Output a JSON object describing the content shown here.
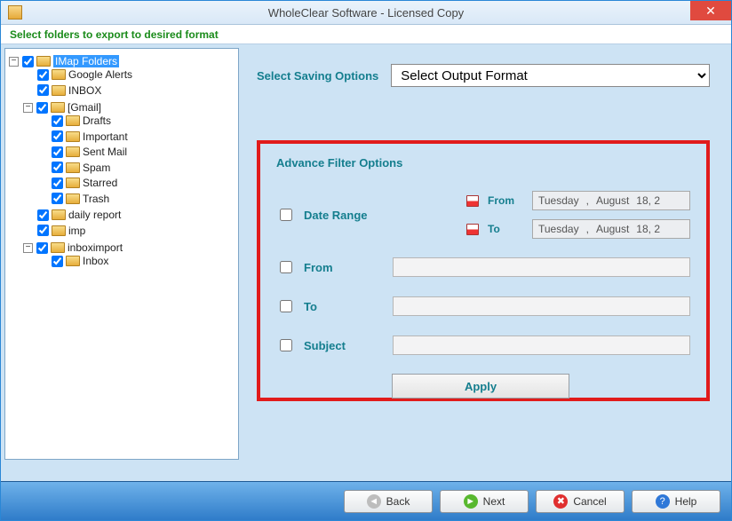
{
  "window": {
    "title": "WholeClear Software - Licensed Copy"
  },
  "banner": "Select folders to export to desired format",
  "tree": {
    "root": {
      "label": "IMap Folders",
      "selected": true,
      "children": [
        {
          "label": "Google Alerts"
        },
        {
          "label": "INBOX"
        },
        {
          "label": "[Gmail]",
          "children": [
            {
              "label": "Drafts"
            },
            {
              "label": "Important"
            },
            {
              "label": "Sent Mail"
            },
            {
              "label": "Spam"
            },
            {
              "label": "Starred"
            },
            {
              "label": "Trash"
            }
          ]
        },
        {
          "label": "daily report"
        },
        {
          "label": "imp"
        },
        {
          "label": "inboximport",
          "children": [
            {
              "label": "Inbox"
            }
          ]
        }
      ]
    }
  },
  "saving": {
    "label": "Select Saving Options",
    "dropdown": "Select Output Format"
  },
  "advance": {
    "title": "Advance Filter Options",
    "date_range_label": "Date Range",
    "from_label": "From",
    "to_label": "To",
    "subject_label": "Subject",
    "date_from_label": "From",
    "date_to_label": "To",
    "date_value": {
      "weekday": "Tuesday",
      "sep": ",",
      "month": "August",
      "day": "18, 2"
    },
    "apply": "Apply"
  },
  "footer": {
    "back": "Back",
    "next": "Next",
    "cancel": "Cancel",
    "help": "Help"
  }
}
